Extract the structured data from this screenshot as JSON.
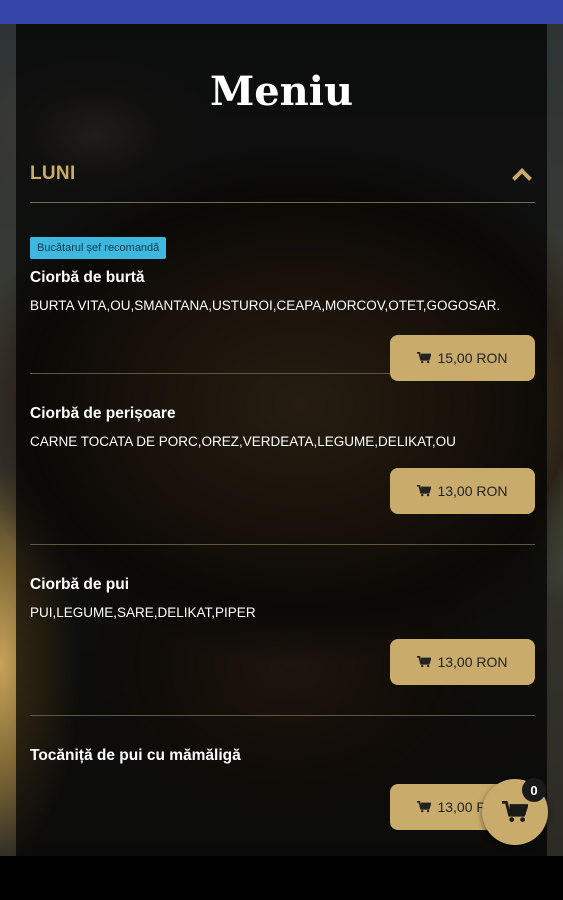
{
  "title": "Meniu",
  "day": {
    "label": "LUNI",
    "expanded": true
  },
  "items": [
    {
      "badge": "Bucătarul șef recomandă",
      "name": "Ciorbă de burtă",
      "description": "BURTA VITA,OU,SMANTANA,USTUROI,CEAPA,MORCOV,OTET,GOGOSAR.",
      "price": "15,00 RON"
    },
    {
      "name": "Ciorbă de perișoare",
      "description": "CARNE TOCATA DE PORC,OREZ,VERDEATA,LEGUME,DELIKAT,OU",
      "price": "13,00 RON"
    },
    {
      "name": "Ciorbă de pui",
      "description": "PUI,LEGUME,SARE,DELIKAT,PIPER",
      "price": "13,00 RON"
    },
    {
      "name": "Tocăniță de pui cu mămăligă",
      "description": "",
      "price": "13,00 RON"
    }
  ],
  "cart": {
    "count": "0",
    "icon": "shopping-cart-icon"
  },
  "colors": {
    "accent": "#c9ab6c",
    "badge": "#3fb8e0",
    "status_bar": "#3546a8"
  }
}
